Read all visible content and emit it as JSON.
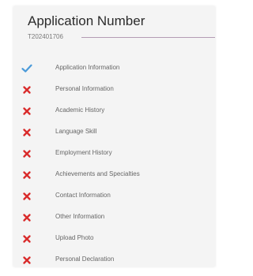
{
  "header": {
    "title": "Application Number",
    "application_number": "T202401706"
  },
  "colors": {
    "complete": "#4a9ad9",
    "incomplete": "#d92b2b",
    "divider": "#b39bb3"
  },
  "steps": [
    {
      "label": "Application Information",
      "status": "complete",
      "icon": "checkmark-icon"
    },
    {
      "label": "Personal Information",
      "status": "incomplete",
      "icon": "cross-icon"
    },
    {
      "label": "Academic History",
      "status": "incomplete",
      "icon": "cross-icon"
    },
    {
      "label": "Language Skill",
      "status": "incomplete",
      "icon": "cross-icon"
    },
    {
      "label": "Employment History",
      "status": "incomplete",
      "icon": "cross-icon"
    },
    {
      "label": "Achievements and Specialties",
      "status": "incomplete",
      "icon": "cross-icon"
    },
    {
      "label": "Contact Information",
      "status": "incomplete",
      "icon": "cross-icon"
    },
    {
      "label": "Other Information",
      "status": "incomplete",
      "icon": "cross-icon"
    },
    {
      "label": "Upload Photo",
      "status": "incomplete",
      "icon": "cross-icon"
    },
    {
      "label": "Personal Declaration",
      "status": "incomplete",
      "icon": "cross-icon"
    }
  ]
}
